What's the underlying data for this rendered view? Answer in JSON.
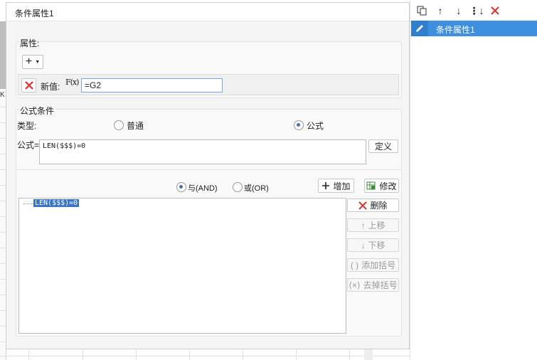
{
  "dialog": {
    "title": "条件属性1",
    "properties": {
      "group_label": "属性:",
      "add_button": "+",
      "new_value_label": "新值:",
      "fx_label": "F(x)",
      "new_value": "=G2"
    },
    "formula_condition": {
      "group_label": "公式条件",
      "type_label": "类型:",
      "radio_normal": "普通",
      "radio_formula": "公式",
      "formula_label": "公式=",
      "formula_value": "LEN($$$)=0",
      "define_button": "定义",
      "and_label": "与(AND)",
      "or_label": "或(OR)",
      "add_button": "增加",
      "modify_button": "修改",
      "delete_button": "删除",
      "move_up_button": "上移",
      "move_down_button": "下移",
      "add_bracket_button": "添加括号",
      "remove_bracket_button": "去掉括号",
      "conditions": [
        "LEN($$$)=0"
      ]
    }
  },
  "sheet": {
    "column_fragment": "K"
  },
  "right_panel": {
    "items": [
      {
        "label": "条件属性1"
      }
    ]
  },
  "colors": {
    "accent": "#3d8fdf",
    "delete": "#e03030"
  }
}
